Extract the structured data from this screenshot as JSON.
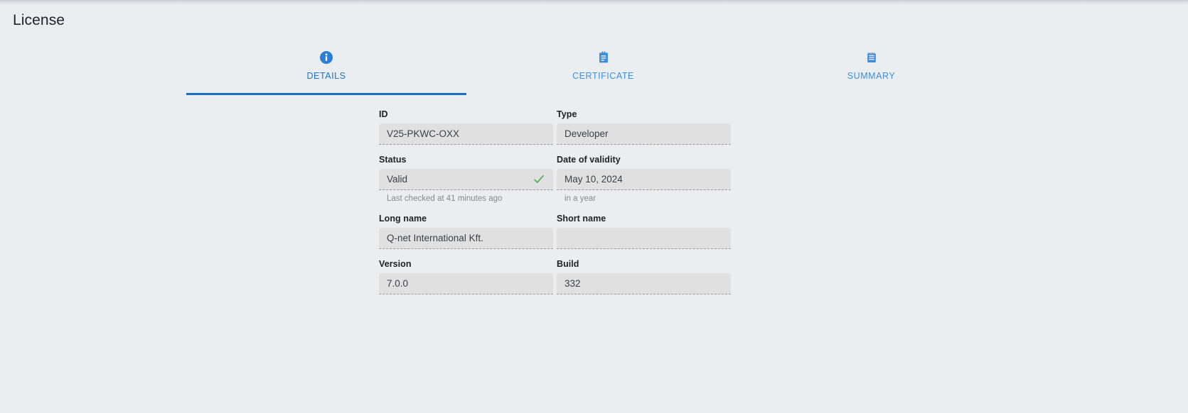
{
  "page": {
    "title": "License"
  },
  "tabs": [
    {
      "label": "DETAILS",
      "icon": "info-circle-icon",
      "active": true
    },
    {
      "label": "CERTIFICATE",
      "icon": "clipboard-icon",
      "active": false
    },
    {
      "label": "SUMMARY",
      "icon": "note-list-icon",
      "active": false
    }
  ],
  "details": {
    "id": {
      "label": "ID",
      "value": "V25-PKWC-OXX"
    },
    "type": {
      "label": "Type",
      "value": "Developer"
    },
    "status": {
      "label": "Status",
      "value": "Valid",
      "help": "Last checked at 41 minutes ago",
      "icon": "check-icon"
    },
    "date_of_validity": {
      "label": "Date of validity",
      "value": "May 10, 2024",
      "help": "in a year"
    },
    "long_name": {
      "label": "Long name",
      "value": "Q-net International Kft."
    },
    "short_name": {
      "label": "Short name",
      "value": ""
    },
    "version": {
      "label": "Version",
      "value": "7.0.0"
    },
    "build": {
      "label": "Build",
      "value": "332"
    }
  },
  "colors": {
    "accent": "#1a6fc4",
    "tab_text": "#3f8ddb",
    "background": "#eaeef0",
    "field_bg": "#e0e0e0",
    "success": "#49b14b"
  }
}
